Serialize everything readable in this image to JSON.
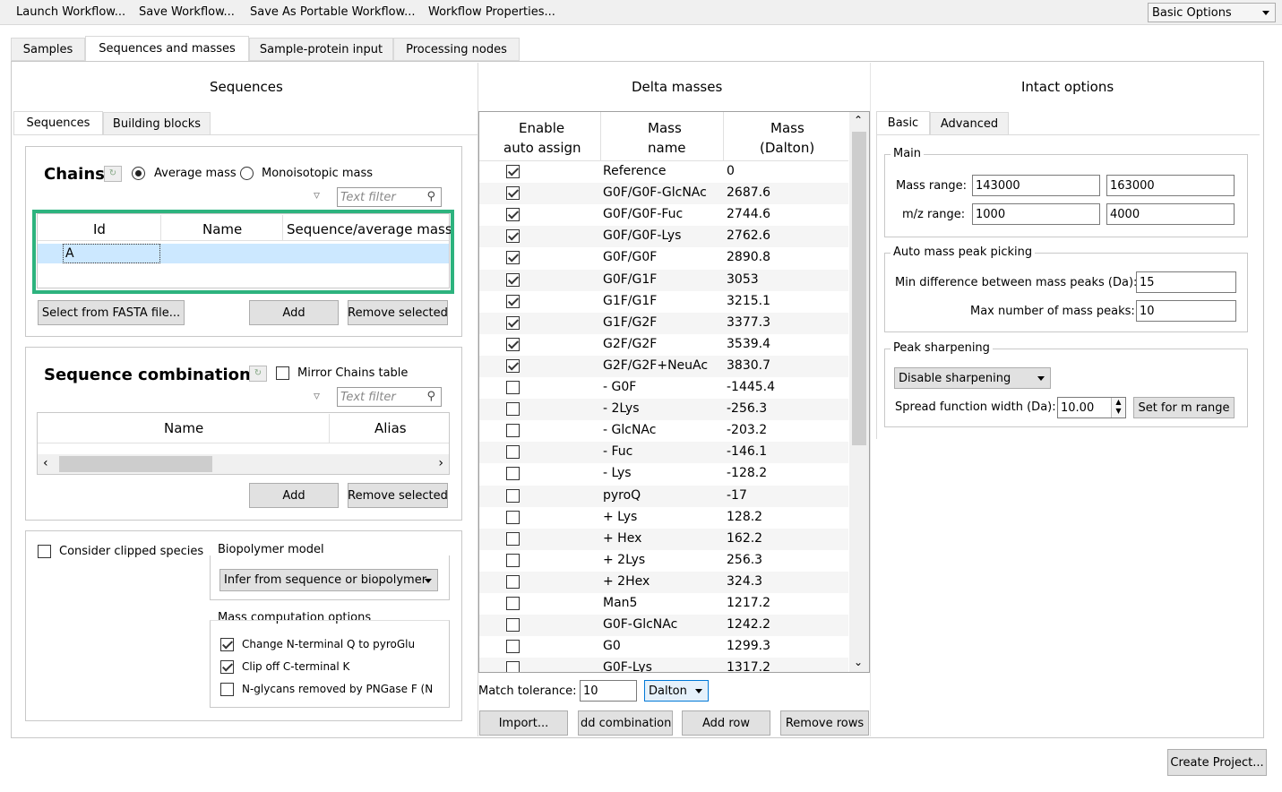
{
  "menubar": {
    "items": [
      "Launch Workflow...",
      "Save Workflow...",
      "Save As Portable Workflow...",
      "Workflow Properties..."
    ],
    "mode_select": "Basic Options"
  },
  "main_tabs": [
    "Samples",
    "Sequences and masses",
    "Sample-protein input",
    "Processing nodes"
  ],
  "sequences": {
    "header": "Sequences",
    "tabs": [
      "Sequences",
      "Building blocks"
    ],
    "chains": {
      "title": "Chains",
      "radio_average": "Average mass",
      "radio_mono": "Monoisotopic mass",
      "filter_placeholder": "Text filter",
      "columns": [
        "Id",
        "Name",
        "Sequence/average mass"
      ],
      "row_id": "A",
      "btn_fasta": "Select from FASTA file...",
      "btn_add": "Add",
      "btn_remove": "Remove selected"
    },
    "combinations": {
      "title": "Sequence combinations",
      "mirror_label": "Mirror Chains table",
      "filter_placeholder": "Text filter",
      "columns": [
        "Name",
        "Alias"
      ],
      "btn_add": "Add",
      "btn_remove": "Remove selected"
    },
    "options": {
      "clipped_label": "Consider clipped species",
      "biopolymer_label": "Biopolymer model",
      "biopolymer_value": "Infer from sequence or biopolymer",
      "mass_comp_label": "Mass computation options",
      "opt1": "Change N-terminal Q to pyroGlu",
      "opt2": "Clip off C-terminal K",
      "opt3": "N-glycans removed by PNGase F (N"
    }
  },
  "delta": {
    "header": "Delta masses",
    "col_enable_1": "Enable",
    "col_enable_2": "auto assign",
    "col_name_1": "Mass",
    "col_name_2": "name",
    "col_mass_1": "Mass",
    "col_mass_2": "(Dalton)",
    "rows": [
      {
        "checked": true,
        "name": "Reference",
        "mass": "0"
      },
      {
        "checked": true,
        "name": "G0F/G0F-GlcNAc",
        "mass": "2687.6"
      },
      {
        "checked": true,
        "name": "G0F/G0F-Fuc",
        "mass": "2744.6"
      },
      {
        "checked": true,
        "name": "G0F/G0F-Lys",
        "mass": "2762.6"
      },
      {
        "checked": true,
        "name": "G0F/G0F",
        "mass": "2890.8"
      },
      {
        "checked": true,
        "name": "G0F/G1F",
        "mass": "3053"
      },
      {
        "checked": true,
        "name": "G1F/G1F",
        "mass": "3215.1"
      },
      {
        "checked": true,
        "name": "G1F/G2F",
        "mass": "3377.3"
      },
      {
        "checked": true,
        "name": "G2F/G2F",
        "mass": "3539.4"
      },
      {
        "checked": true,
        "name": "G2F/G2F+NeuAc",
        "mass": "3830.7"
      },
      {
        "checked": false,
        "name": "- G0F",
        "mass": "-1445.4"
      },
      {
        "checked": false,
        "name": "- 2Lys",
        "mass": "-256.3"
      },
      {
        "checked": false,
        "name": "- GlcNAc",
        "mass": "-203.2"
      },
      {
        "checked": false,
        "name": "- Fuc",
        "mass": "-146.1"
      },
      {
        "checked": false,
        "name": "- Lys",
        "mass": "-128.2"
      },
      {
        "checked": false,
        "name": "pyroQ",
        "mass": "-17"
      },
      {
        "checked": false,
        "name": "+ Lys",
        "mass": "128.2"
      },
      {
        "checked": false,
        "name": "+ Hex",
        "mass": "162.2"
      },
      {
        "checked": false,
        "name": "+ 2Lys",
        "mass": "256.3"
      },
      {
        "checked": false,
        "name": "+ 2Hex",
        "mass": "324.3"
      },
      {
        "checked": false,
        "name": "Man5",
        "mass": "1217.2"
      },
      {
        "checked": false,
        "name": "G0F-GlcNAc",
        "mass": "1242.2"
      },
      {
        "checked": false,
        "name": "G0",
        "mass": "1299.3"
      },
      {
        "checked": false,
        "name": "G0F-Lys",
        "mass": "1317.2"
      }
    ],
    "tolerance_label": "Match tolerance:",
    "tolerance_value": "10",
    "tolerance_unit": "Dalton",
    "btn_import": "Import...",
    "btn_add_comb": "dd combinations.",
    "btn_add_row": "Add row",
    "btn_remove_rows": "Remove rows"
  },
  "intact": {
    "header": "Intact options",
    "tabs": [
      "Basic",
      "Advanced"
    ],
    "main_label": "Main",
    "mass_range_label": "Mass range:",
    "mass_range_min": "143000",
    "mass_range_max": "163000",
    "mz_range_label": "m/z range:",
    "mz_min": "1000",
    "mz_max": "4000",
    "auto_label": "Auto mass peak picking",
    "min_diff_label": "Min difference between mass peaks (Da):",
    "min_diff_value": "15",
    "max_num_label": "Max number of mass peaks:",
    "max_num_value": "10",
    "sharpen_label": "Peak sharpening",
    "sharpen_value": "Disable sharpening",
    "spread_label": "Spread function width (Da):",
    "spread_value": "10.00",
    "btn_set_range": "Set for m range"
  },
  "footer": {
    "create_project": "Create Project..."
  },
  "colors": {
    "highlight": "#2db37e",
    "selected_row": "#cce8ff"
  }
}
